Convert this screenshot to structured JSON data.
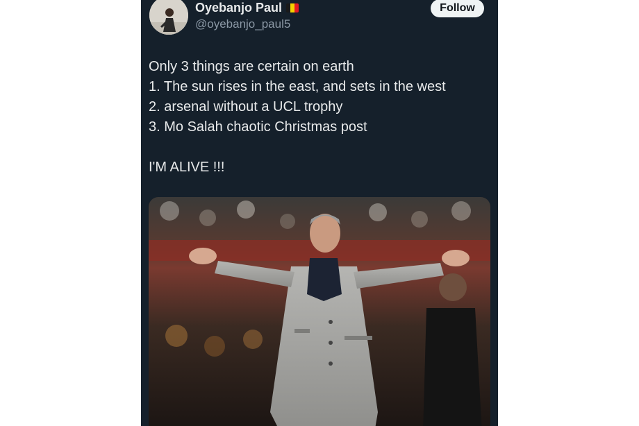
{
  "author": {
    "name": "Oyebanjo Paul",
    "handle": "@oyebanjo_paul5",
    "flag_colors": [
      "#1a1a1a",
      "#f5d100",
      "#e31c23"
    ],
    "avatar_icon": "profile-photo"
  },
  "follow_button": {
    "label": "Follow"
  },
  "tweet": {
    "lines": [
      "Only 3 things are certain on earth",
      "1. The sun rises in the east, and sets in the west",
      "2. arsenal without a UCL trophy",
      "3. Mo Salah chaotic Christmas post"
    ],
    "closing": "I'M ALIVE !!!"
  },
  "media": {
    "icon": "photo-man-in-grey-coat-arms-outstretched"
  }
}
